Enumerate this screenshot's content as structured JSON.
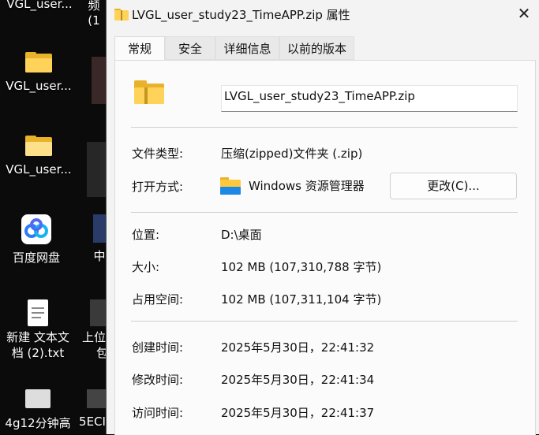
{
  "desktop": {
    "items": [
      {
        "label": "VGL_user..."
      },
      {
        "label": "VGL_user..."
      },
      {
        "label": "百度网盘"
      },
      {
        "label": "新建 文本文"
      },
      {
        "label": "档 (2).txt"
      },
      {
        "label": "4g12分钟高"
      },
      {
        "label": "5ECI"
      },
      {
        "label": "上位"
      },
      {
        "label": "包"
      },
      {
        "label": "中"
      }
    ],
    "top_fragments": [
      "VGL_user...",
      "频",
      "(1"
    ]
  },
  "dialog": {
    "title": "LVGL_user_study23_TimeAPP.zip 属性",
    "close_glyph": "✕",
    "tabs": [
      {
        "label": "常规"
      },
      {
        "label": "安全"
      },
      {
        "label": "详细信息"
      },
      {
        "label": "以前的版本"
      }
    ],
    "filename": "LVGL_user_study23_TimeAPP.zip",
    "file_type_label": "文件类型:",
    "file_type_value": "压缩(zipped)文件夹 (.zip)",
    "open_with_label": "打开方式:",
    "open_with_value": "Windows 资源管理器",
    "change_button": "更改(C)...",
    "location_label": "位置:",
    "location_value": "D:\\桌面",
    "size_label": "大小:",
    "size_value": "102 MB (107,310,788 字节)",
    "size_on_disk_label": "占用空间:",
    "size_on_disk_value": "102 MB (107,311,104 字节)",
    "created_label": "创建时间:",
    "created_value": "2025年5月30日，22:41:32",
    "modified_label": "修改时间:",
    "modified_value": "2025年5月30日，22:41:34",
    "accessed_label": "访问时间:",
    "accessed_value": "2025年5月30日，22:41:37"
  },
  "colors": {
    "folder_yellow": "#ffd35a",
    "folder_dark": "#e8b22a",
    "dialog_bg": "#f3f3f3",
    "panel_bg": "#fbfbfb"
  }
}
